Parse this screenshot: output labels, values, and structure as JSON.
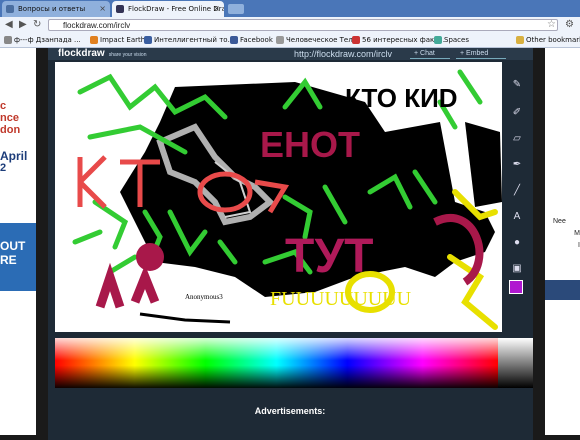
{
  "browser": {
    "tabs": [
      {
        "label": "Вопросы и ответы",
        "active": false
      },
      {
        "label": "FlockDraw - Free Online Draw",
        "active": true
      }
    ],
    "address": "flockdraw.com/irclv",
    "bookmarks": [
      "ф---ф Дзанпада ...",
      "Impact Earth!",
      "Интеллигентный то...",
      "Facebook",
      "Человеческое Тело",
      "56 интересных факт...",
      "Spaces"
    ],
    "other_bookmarks": "Other bookmarks"
  },
  "app": {
    "logo": "flockdraw",
    "tagline": "share your vision",
    "url": "http://flockdraw.com/irclv",
    "chat_button": "+ Chat",
    "embed_button": "+ Embed",
    "current_color": "#b018d0"
  },
  "canvas": {
    "texts": [
      "КТО КИD",
      "ЕНОТ",
      "КТ",
      "ТУТ",
      "FUUUUUUUUU",
      "Anonymous3",
      "Anonymous3"
    ]
  },
  "left_ad": {
    "line1": "c",
    "line2": "nce",
    "line3": "don",
    "line4": "April",
    "line5": "2",
    "box1": "OUT",
    "box2": "RE"
  },
  "right_ad": {
    "line1": "Nee",
    "line2": "M",
    "line3": "I"
  },
  "footer": {
    "ads_label": "Advertisements:"
  }
}
